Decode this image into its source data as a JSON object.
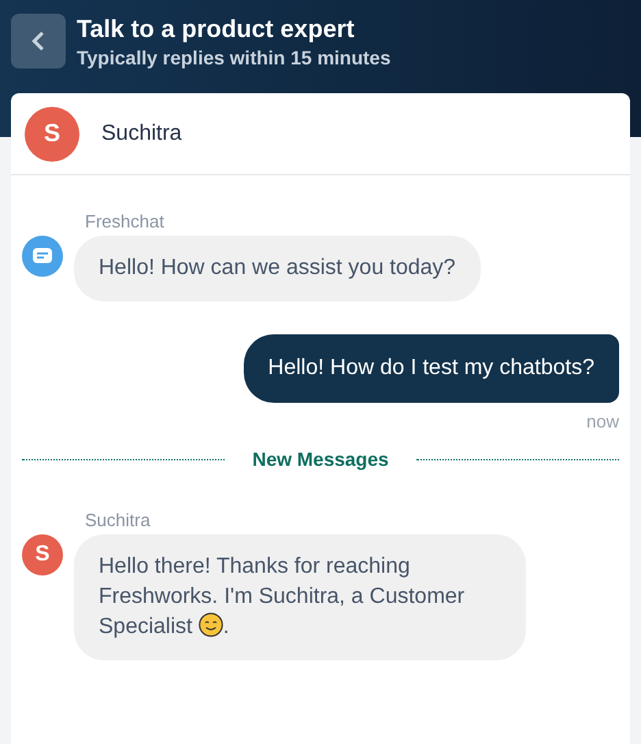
{
  "header": {
    "title": "Talk to a product expert",
    "subtitle": "Typically replies within 15 minutes"
  },
  "agent": {
    "initial": "S",
    "name": "Suchitra"
  },
  "messages": [
    {
      "kind": "incoming",
      "bot": true,
      "sender": "Freshchat",
      "text": "Hello! How can we assist you today?"
    },
    {
      "kind": "outgoing",
      "text": "Hello! How do I test my chatbots?",
      "time": "now"
    },
    {
      "kind": "divider",
      "text": "New Messages"
    },
    {
      "kind": "incoming",
      "bot": false,
      "initial": "S",
      "sender": "Suchitra",
      "text": "Hello there! Thanks for reaching Freshworks. I'm Suchitra, a Customer Specialist ",
      "emoji": true,
      "suffix": "."
    }
  ]
}
